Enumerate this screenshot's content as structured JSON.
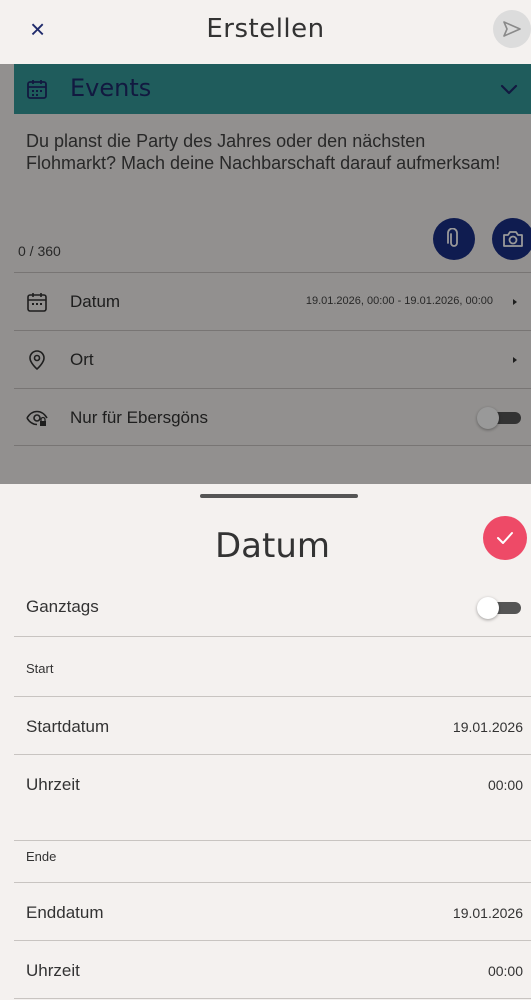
{
  "header": {
    "close_label": "×",
    "title": "Erstellen"
  },
  "category": {
    "label": "Events",
    "icon": "calendar-icon"
  },
  "post": {
    "description": "Du planst die Party des Jahres oder den nächsten Flohmarkt? Mach deine Nachbarschaft darauf aufmerksam!",
    "counter": "0 / 360"
  },
  "rows": {
    "date_label": "Datum",
    "date_value": "19.01.2026, 00:00 - 19.01.2026, 00:00",
    "location_label": "Ort",
    "visibility_label": "Nur für Ebersgöns",
    "visibility_on": false
  },
  "sheet": {
    "title": "Datum",
    "allday_label": "Ganztags",
    "allday_on": false,
    "start_section": "Start",
    "start_date_label": "Startdatum",
    "start_date_value": "19.01.2026",
    "start_time_label": "Uhrzeit",
    "start_time_value": "00:00",
    "end_section": "Ende",
    "end_date_label": "Enddatum",
    "end_date_value": "19.01.2026",
    "end_time_label": "Uhrzeit",
    "end_time_value": "00:00"
  },
  "colors": {
    "accent_teal": "#359a9a",
    "navy": "#1a2f86",
    "confirm_pink": "#ee4a67",
    "background": "#f4f1ef"
  }
}
